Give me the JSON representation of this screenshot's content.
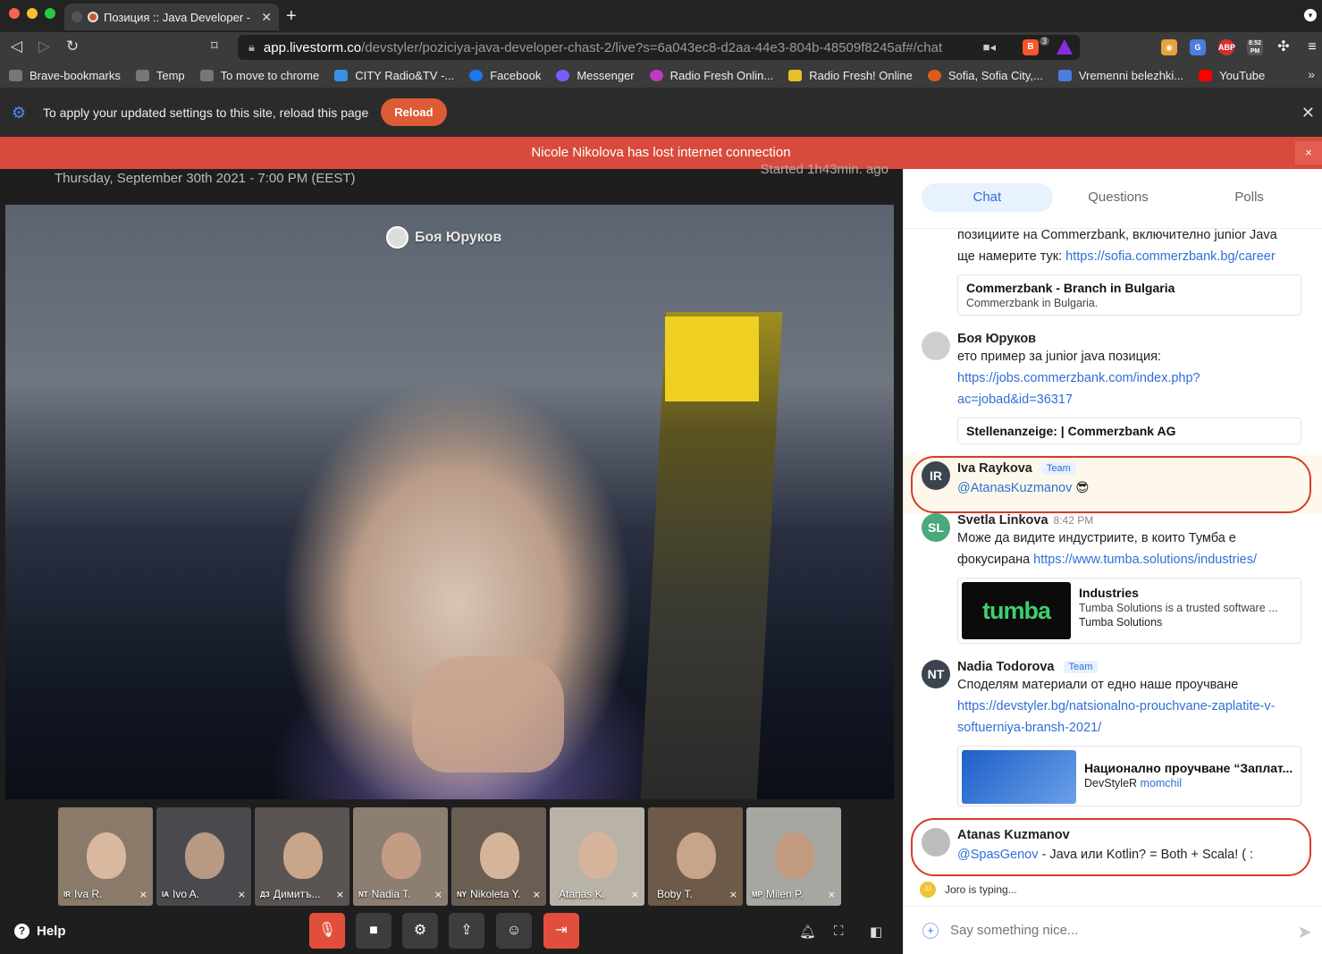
{
  "browser": {
    "tab_title": "Позиция :: Java Developer - ",
    "url_host": "app.livestorm.co",
    "url_path": "/devstyler/poziciya-java-developer-chast-2/live?s=6a043ec8-d2aa-44e3-804b-48509f8245af#/chat",
    "brave_badge": "3",
    "bookmarks": [
      {
        "label": "Brave-bookmarks",
        "color": "#777777"
      },
      {
        "label": "Temp",
        "color": "#777777"
      },
      {
        "label": "To move to chrome",
        "color": "#777777"
      },
      {
        "label": "CITY Radio&TV -...",
        "color": "#3a8ee6"
      },
      {
        "label": "Facebook",
        "color": "#1877f2"
      },
      {
        "label": "Messenger",
        "color": "#7b5cff"
      },
      {
        "label": "Radio Fresh Onlin...",
        "color": "#c03ac0"
      },
      {
        "label": "Radio Fresh! Online",
        "color": "#e6c229"
      },
      {
        "label": "Sofia, Sofia City,...",
        "color": "#e05a1e"
      },
      {
        "label": "Vremenni belezhki...",
        "color": "#4a7de0"
      },
      {
        "label": "YouTube",
        "color": "#ff0000"
      }
    ],
    "info_message": "To apply your updated settings to this site, reload this page",
    "reload_label": "Reload"
  },
  "alert": {
    "message": "Nicole Nikolova has lost internet connection",
    "close": "×"
  },
  "event": {
    "date": "Thursday, September 30th 2021 - 7:00 PM (EEST)",
    "started": "Started 1h43min. ago"
  },
  "speaker": {
    "name": "Боя Юруков"
  },
  "participants": [
    {
      "initials": "IR",
      "name": "Iva R.",
      "bg": "#8a7a6a",
      "head": "#d8b89e"
    },
    {
      "initials": "IA",
      "name": "Ivo A.",
      "bg": "#4a4a4e",
      "head": "#b89a84"
    },
    {
      "initials": "ДЗ",
      "name": "Димитъ...",
      "bg": "#5a5552",
      "head": "#c9a58a"
    },
    {
      "initials": "NT",
      "name": "Nadia T.",
      "bg": "#8c7f72",
      "head": "#c49c84"
    },
    {
      "initials": "NY",
      "name": "Nikoleta Y.",
      "bg": "#6a5e52",
      "head": "#d6b49a"
    },
    {
      "initials": "",
      "name": "Atanas K.",
      "bg": "#b9b2a6",
      "head": "#d6b49c"
    },
    {
      "initials": "",
      "name": "Boby T.",
      "bg": "#6e5a48",
      "head": "#c7a48a"
    },
    {
      "initials": "MP",
      "name": "Milen P.",
      "bg": "#a8a6a0",
      "head": "#c19a80"
    }
  ],
  "controls": {
    "help_label": "Help"
  },
  "sidebar": {
    "tabs": [
      {
        "label": "Chat",
        "active": true
      },
      {
        "label": "Questions",
        "active": false
      },
      {
        "label": "Polls",
        "active": false
      }
    ],
    "messages": [
      {
        "text_line1": "позициите на Commerzbank, включително junior Java",
        "text_line2": "ще намерите тук: ",
        "link": "https://sofia.commerzbank.bg/career",
        "card_title": "Commerzbank - Branch in Bulgaria",
        "card_desc": "Commerzbank in Bulgaria."
      },
      {
        "author": "Боя Юруков",
        "text": "ето пример за junior java позиция:",
        "link_line1": "https://jobs.commerzbank.com/index.php?",
        "link_line2": "ac=jobad&id=36317",
        "card_title": "Stellenanzeige: | Commerzbank AG"
      },
      {
        "initials": "IR",
        "author": "Iva Raykova",
        "badge": "Team",
        "mention": "@AtanasKuzmanov",
        "emoji": "😎",
        "avatar_color": "#3c4450"
      },
      {
        "initials": "SL",
        "author": "Svetla Linkova",
        "time": "8:42 PM",
        "text_line1": "Може да видите индустриите, в които Тумба е",
        "text_line2": "фокусирана ",
        "link": "https://www.tumba.solutions/industries/",
        "card_logo": "tumba",
        "card_title": "Industries",
        "card_desc": "Tumba Solutions is a trusted software ...",
        "card_site": "Tumba Solutions",
        "avatar_color": "#4aa87c"
      },
      {
        "initials": "NT",
        "author": "Nadia Todorova",
        "badge": "Team",
        "text": "Споделям материали от едно наше проучване",
        "link_line1": "https://devstyler.bg/natsionalno-prouchvane-zaplatite-v-",
        "link_line2": "softuerniya-bransh-2021/",
        "card_title": "Национално проучване “Заплат...",
        "card_site": "DevStyleR",
        "card_author": "momchil",
        "avatar_color": "#3c4450"
      },
      {
        "author": "Atanas Kuzmanov",
        "mention": "@SpasGenov",
        "text": " - Java или Kotlin? = Both + Scala! ( :"
      }
    ],
    "typing": {
      "initials": "JJ",
      "text": "Joro is typing..."
    },
    "composer_placeholder": "Say something nice..."
  },
  "colors": {
    "accent": "#2f6fd8",
    "alert": "#d84b3c",
    "danger_button": "#e14f3c",
    "highlight_ring": "#d43d2a"
  }
}
